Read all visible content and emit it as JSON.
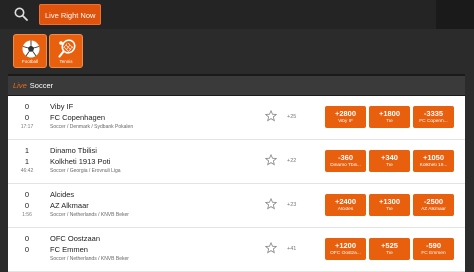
{
  "topbar": {
    "live_label": "Live Right Now"
  },
  "sports": [
    {
      "label": "Football",
      "icon": "soccer-ball-icon"
    },
    {
      "label": "Tennis",
      "icon": "tennis-racket-icon"
    }
  ],
  "section": {
    "live_tag": "Live",
    "title": "Soccer"
  },
  "matches": [
    {
      "home_score": "0",
      "away_score": "0",
      "time": "17:17",
      "home": "Viby IF",
      "away": "FC Copenhagen",
      "meta": "Soccer / Denmark / Sydbank Pokalen",
      "more": "+25",
      "odds": [
        {
          "value": "+2800",
          "name": "Viby IF"
        },
        {
          "value": "+1800",
          "name": "Tie"
        },
        {
          "value": "-3335",
          "name": "FC Copenh..."
        }
      ]
    },
    {
      "home_score": "1",
      "away_score": "1",
      "time": "46:42",
      "home": "Dinamo Tbilisi",
      "away": "Kolkheti 1913 Poti",
      "meta": "Soccer / Georgia / Erovnuli Liga",
      "more": "+22",
      "odds": [
        {
          "value": "-360",
          "name": "Dinamo Tbili..."
        },
        {
          "value": "+340",
          "name": "Tie"
        },
        {
          "value": "+1050",
          "name": "Kolkheti 19..."
        }
      ]
    },
    {
      "home_score": "0",
      "away_score": "0",
      "time": "1:56",
      "home": "Alcides",
      "away": "AZ Alkmaar",
      "meta": "Soccer / Netherlands / KNVB Beker",
      "more": "+23",
      "odds": [
        {
          "value": "+2400",
          "name": "Alcides"
        },
        {
          "value": "+1300",
          "name": "Tie"
        },
        {
          "value": "-2500",
          "name": "AZ Alkmaar"
        }
      ]
    },
    {
      "home_score": "0",
      "away_score": "0",
      "time": "",
      "home": "OFC Oostzaan",
      "away": "FC Emmen",
      "meta": "Soccer / Netherlands / KNVB Beker",
      "more": "+41",
      "odds": [
        {
          "value": "+1200",
          "name": "OFC Oostza..."
        },
        {
          "value": "+525",
          "name": "Tie"
        },
        {
          "value": "-590",
          "name": "FC Emmen"
        }
      ]
    }
  ],
  "colors": {
    "accent": "#e8600e",
    "live_tag": "#f06a1c",
    "header_bg": "#3a3a3a"
  }
}
